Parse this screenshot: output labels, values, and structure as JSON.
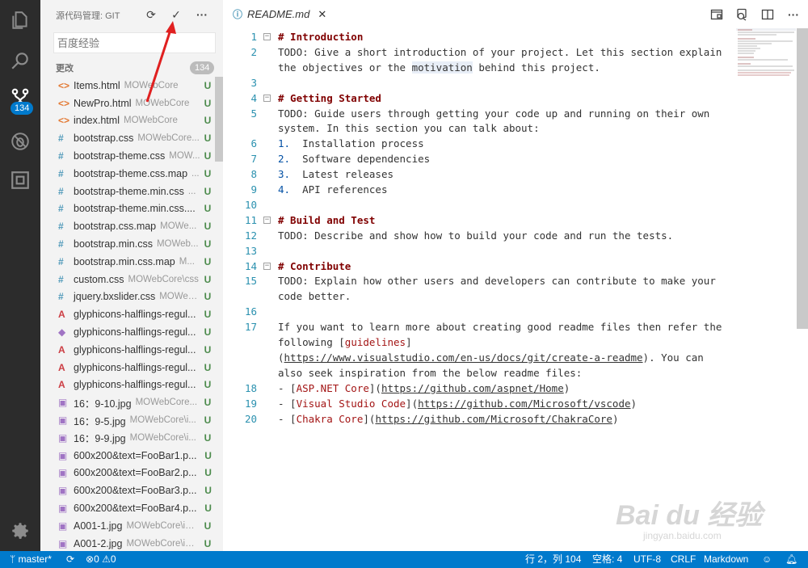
{
  "activity_bar": {
    "scm_badge": "134"
  },
  "sidebar": {
    "title": "源代码管理: GIT",
    "commit_placeholder": "百度经验",
    "changes_label": "更改",
    "changes_count": "134",
    "files": [
      {
        "icon": "code-file-icon",
        "glyph": "<>",
        "name": "Items.html",
        "path": "MOWebCore",
        "status": "U",
        "color": "#e37933"
      },
      {
        "icon": "code-file-icon",
        "glyph": "<>",
        "name": "NewPro.html",
        "path": "MOWebCore",
        "status": "U",
        "color": "#e37933"
      },
      {
        "icon": "code-file-icon",
        "glyph": "<>",
        "name": "index.html",
        "path": "MOWebCore",
        "status": "U",
        "color": "#e37933"
      },
      {
        "icon": "css-file-icon",
        "glyph": "#",
        "name": "bootstrap.css",
        "path": "MOWebCore...",
        "status": "U",
        "color": "#519aba"
      },
      {
        "icon": "css-file-icon",
        "glyph": "#",
        "name": "bootstrap-theme.css",
        "path": "MOW...",
        "status": "U",
        "color": "#519aba"
      },
      {
        "icon": "css-file-icon",
        "glyph": "#",
        "name": "bootstrap-theme.css.map",
        "path": "...",
        "status": "U",
        "color": "#519aba"
      },
      {
        "icon": "css-file-icon",
        "glyph": "#",
        "name": "bootstrap-theme.min.css",
        "path": "...",
        "status": "U",
        "color": "#519aba"
      },
      {
        "icon": "css-file-icon",
        "glyph": "#",
        "name": "bootstrap-theme.min.css....",
        "path": "",
        "status": "U",
        "color": "#519aba"
      },
      {
        "icon": "css-file-icon",
        "glyph": "#",
        "name": "bootstrap.css.map",
        "path": "MOWe...",
        "status": "U",
        "color": "#519aba"
      },
      {
        "icon": "css-file-icon",
        "glyph": "#",
        "name": "bootstrap.min.css",
        "path": "MOWeb...",
        "status": "U",
        "color": "#519aba"
      },
      {
        "icon": "css-file-icon",
        "glyph": "#",
        "name": "bootstrap.min.css.map",
        "path": "M...",
        "status": "U",
        "color": "#519aba"
      },
      {
        "icon": "css-file-icon",
        "glyph": "#",
        "name": "custom.css",
        "path": "MOWebCore\\css",
        "status": "U",
        "color": "#519aba"
      },
      {
        "icon": "css-file-icon",
        "glyph": "#",
        "name": "jquery.bxslider.css",
        "path": "MOWeb...",
        "status": "U",
        "color": "#519aba"
      },
      {
        "icon": "font-file-icon",
        "glyph": "A",
        "name": "glyphicons-halflings-regul...",
        "path": "",
        "status": "U",
        "color": "#cc3e44"
      },
      {
        "icon": "svg-file-icon",
        "glyph": "◆",
        "name": "glyphicons-halflings-regul...",
        "path": "",
        "status": "U",
        "color": "#a074c4"
      },
      {
        "icon": "font-file-icon",
        "glyph": "A",
        "name": "glyphicons-halflings-regul...",
        "path": "",
        "status": "U",
        "color": "#cc3e44"
      },
      {
        "icon": "font-file-icon",
        "glyph": "A",
        "name": "glyphicons-halflings-regul...",
        "path": "",
        "status": "U",
        "color": "#cc3e44"
      },
      {
        "icon": "font-file-icon",
        "glyph": "A",
        "name": "glyphicons-halflings-regul...",
        "path": "",
        "status": "U",
        "color": "#cc3e44"
      },
      {
        "icon": "image-file-icon",
        "glyph": "▣",
        "name": "16：9-10.jpg",
        "path": "MOWebCore...",
        "status": "U",
        "color": "#a074c4"
      },
      {
        "icon": "image-file-icon",
        "glyph": "▣",
        "name": "16：9-5.jpg",
        "path": "MOWebCore\\i...",
        "status": "U",
        "color": "#a074c4"
      },
      {
        "icon": "image-file-icon",
        "glyph": "▣",
        "name": "16：9-9.jpg",
        "path": "MOWebCore\\i...",
        "status": "U",
        "color": "#a074c4"
      },
      {
        "icon": "image-file-icon",
        "glyph": "▣",
        "name": "600x200&text=FooBar1.p...",
        "path": "",
        "status": "U",
        "color": "#a074c4"
      },
      {
        "icon": "image-file-icon",
        "glyph": "▣",
        "name": "600x200&text=FooBar2.p...",
        "path": "",
        "status": "U",
        "color": "#a074c4"
      },
      {
        "icon": "image-file-icon",
        "glyph": "▣",
        "name": "600x200&text=FooBar3.p...",
        "path": "",
        "status": "U",
        "color": "#a074c4"
      },
      {
        "icon": "image-file-icon",
        "glyph": "▣",
        "name": "600x200&text=FooBar4.p...",
        "path": "",
        "status": "U",
        "color": "#a074c4"
      },
      {
        "icon": "image-file-icon",
        "glyph": "▣",
        "name": "A001-1.jpg",
        "path": "MOWebCore\\im...",
        "status": "U",
        "color": "#a074c4"
      },
      {
        "icon": "image-file-icon",
        "glyph": "▣",
        "name": "A001-2.jpg",
        "path": "MOWebCore\\im...",
        "status": "U",
        "color": "#a074c4"
      }
    ]
  },
  "editor": {
    "tab_label": "README.md",
    "lines": [
      {
        "n": "1",
        "fold": true,
        "html": "<span class='h'># Introduction</span>"
      },
      {
        "n": "2",
        "fold": false,
        "html": "TODO: Give a short introduction of your project. Let this section explain"
      },
      {
        "n": "",
        "fold": false,
        "html": "the objectives or the <span class='hl'>motivation</span> behind this project."
      },
      {
        "n": "3",
        "fold": false,
        "html": ""
      },
      {
        "n": "4",
        "fold": true,
        "html": "<span class='h'># Getting Started</span>"
      },
      {
        "n": "5",
        "fold": false,
        "html": "TODO: Guide users through getting your code up and running on their own"
      },
      {
        "n": "",
        "fold": false,
        "html": "system. In this section you can talk about:"
      },
      {
        "n": "6",
        "fold": false,
        "html": "<span class='bl'>1.</span>  Installation process"
      },
      {
        "n": "7",
        "fold": false,
        "html": "<span class='bl'>2.</span>  Software dependencies"
      },
      {
        "n": "8",
        "fold": false,
        "html": "<span class='bl'>3.</span>  Latest releases"
      },
      {
        "n": "9",
        "fold": false,
        "html": "<span class='bl'>4.</span>  API references"
      },
      {
        "n": "10",
        "fold": false,
        "html": ""
      },
      {
        "n": "11",
        "fold": true,
        "html": "<span class='h'># Build and Test</span>"
      },
      {
        "n": "12",
        "fold": false,
        "html": "TODO: Describe and show how to build your code and run the tests."
      },
      {
        "n": "13",
        "fold": false,
        "html": ""
      },
      {
        "n": "14",
        "fold": true,
        "html": "<span class='h'># Contribute</span>"
      },
      {
        "n": "15",
        "fold": false,
        "html": "TODO: Explain how other users and developers can contribute to make your"
      },
      {
        "n": "",
        "fold": false,
        "html": "code better."
      },
      {
        "n": "16",
        "fold": false,
        "html": ""
      },
      {
        "n": "17",
        "fold": false,
        "html": "If you want to learn more about creating good readme files then refer the"
      },
      {
        "n": "",
        "fold": false,
        "html": "following [<span class='lk'>guidelines</span>]"
      },
      {
        "n": "",
        "fold": false,
        "html": "(<span class='ul'>https://www.visualstudio.com/en-us/docs/git/create-a-readme</span>). You can"
      },
      {
        "n": "",
        "fold": false,
        "html": "also seek inspiration from the below readme files:"
      },
      {
        "n": "18",
        "fold": false,
        "html": "- [<span class='lk'>ASP.NET Core</span>](<span class='ul'>https://github.com/aspnet/Home</span>)"
      },
      {
        "n": "19",
        "fold": false,
        "html": "- [<span class='lk'>Visual Studio Code</span>](<span class='ul'>https://github.com/Microsoft/vscode</span>)"
      },
      {
        "n": "20",
        "fold": false,
        "html": "- [<span class='lk'>Chakra Core</span>](<span class='ul'>https://github.com/Microsoft/ChakraCore</span>)"
      }
    ]
  },
  "statusbar": {
    "branch": "master*",
    "errors": "0",
    "warnings": "0",
    "position": "行 2，列 104",
    "indent": "空格: 4",
    "encoding": "UTF-8",
    "eol": "CRLF",
    "language": "Markdown"
  },
  "watermark": {
    "text": "Bai du 经验",
    "sub": "jingyan.baidu.com"
  },
  "colors": {
    "accent": "#007acc",
    "untracked": "#4c8b4c",
    "annotation_arrow": "#e02020"
  }
}
